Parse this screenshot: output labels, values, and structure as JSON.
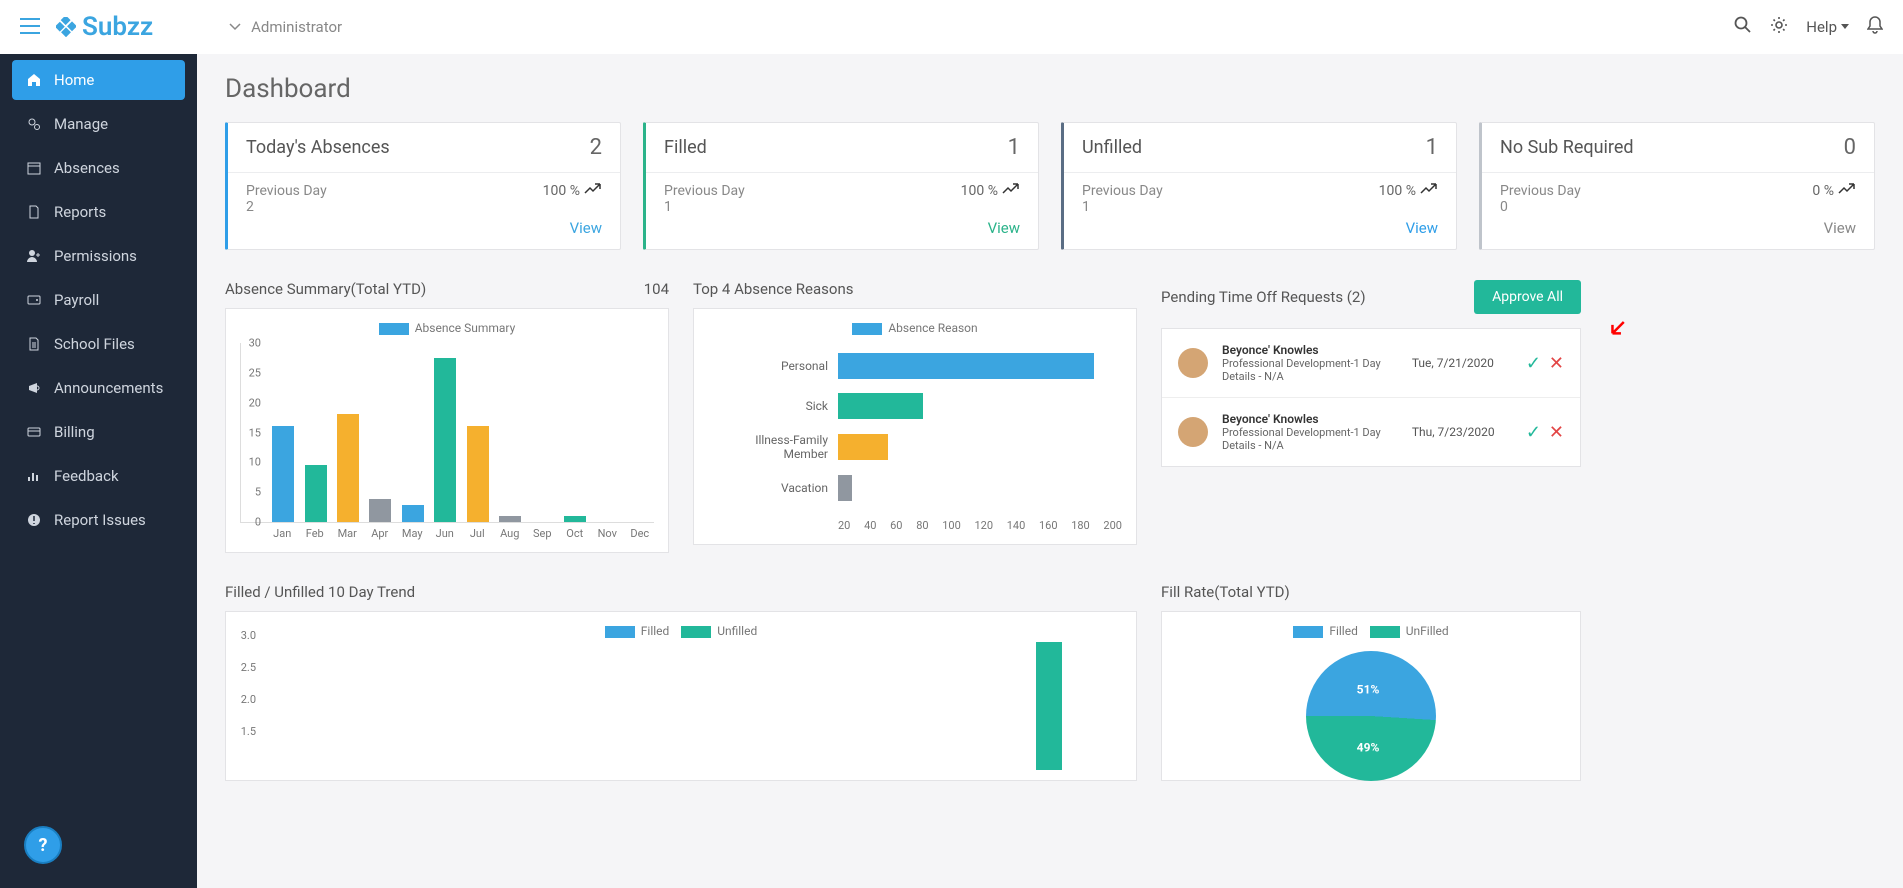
{
  "topbar": {
    "role": "Administrator",
    "help": "Help"
  },
  "sidebar": {
    "items": [
      {
        "label": "Home"
      },
      {
        "label": "Manage"
      },
      {
        "label": "Absences"
      },
      {
        "label": "Reports"
      },
      {
        "label": "Permissions"
      },
      {
        "label": "Payroll"
      },
      {
        "label": "School Files"
      },
      {
        "label": "Announcements"
      },
      {
        "label": "Billing"
      },
      {
        "label": "Feedback"
      },
      {
        "label": "Report Issues"
      }
    ]
  },
  "page": {
    "title": "Dashboard"
  },
  "stats": [
    {
      "title": "Today's Absences",
      "count": "2",
      "prev_label": "Previous Day",
      "prev_val": "2",
      "pct": "100 %",
      "view": "View"
    },
    {
      "title": "Filled",
      "count": "1",
      "prev_label": "Previous Day",
      "prev_val": "1",
      "pct": "100 %",
      "view": "View"
    },
    {
      "title": "Unfilled",
      "count": "1",
      "prev_label": "Previous Day",
      "prev_val": "1",
      "pct": "100 %",
      "view": "View"
    },
    {
      "title": "No Sub Required",
      "count": "0",
      "prev_label": "Previous Day",
      "prev_val": "0",
      "pct": "0 %",
      "view": "View"
    }
  ],
  "absence_summary": {
    "title": "Absence Summary(Total YTD)",
    "total": "104",
    "legend": "Absence Summary"
  },
  "top_reasons": {
    "title": "Top 4 Absence Reasons",
    "legend": "Absence Reason"
  },
  "pending": {
    "title": "Pending Time Off Requests (2)",
    "approve": "Approve All",
    "items": [
      {
        "name": "Beyonce' Knowles",
        "desc": "Professional Development-1 Day",
        "details": "Details - N/A",
        "date": "Tue, 7/21/2020"
      },
      {
        "name": "Beyonce' Knowles",
        "desc": "Professional Development-1 Day",
        "details": "Details - N/A",
        "date": "Thu, 7/23/2020"
      }
    ]
  },
  "trend": {
    "title": "Filled / Unfilled 10 Day Trend",
    "legend_filled": "Filled",
    "legend_unfilled": "Unfilled"
  },
  "fill_rate": {
    "title": "Fill Rate(Total YTD)",
    "legend_filled": "Filled",
    "legend_unfilled": "UnFilled",
    "filled_pct": "51%",
    "unfilled_pct": "49%"
  },
  "chart_data": [
    {
      "type": "bar",
      "name": "Absence Summary (Total YTD)",
      "categories": [
        "Jan",
        "Feb",
        "Mar",
        "Apr",
        "May",
        "Jun",
        "Jul",
        "Aug",
        "Sep",
        "Oct",
        "Nov",
        "Dec"
      ],
      "values": [
        17,
        10,
        19,
        4,
        3,
        29,
        17,
        1,
        0,
        1,
        0,
        0
      ],
      "colors": [
        "#3ba5e0",
        "#22b89a",
        "#f5b02e",
        "#9097a0",
        "#3ba5e0",
        "#22b89a",
        "#f5b02e",
        "#9097a0",
        "#3ba5e0",
        "#22b89a",
        "#f5b02e",
        "#9097a0"
      ],
      "ylim": [
        0,
        30
      ],
      "yticks": [
        0,
        5,
        10,
        15,
        20,
        25,
        30
      ]
    },
    {
      "type": "bar",
      "name": "Top 4 Absence Reasons",
      "orientation": "horizontal",
      "categories": [
        "Personal",
        "Sick",
        "Illness-Family Member",
        "Vacation"
      ],
      "values": [
        180,
        60,
        35,
        10
      ],
      "colors": [
        "#3ba5e0",
        "#22b89a",
        "#f5b02e",
        "#9097a0"
      ],
      "xlim": [
        0,
        200
      ],
      "xticks": [
        20,
        40,
        60,
        80,
        100,
        120,
        140,
        160,
        180,
        200
      ]
    },
    {
      "type": "bar",
      "name": "Filled / Unfilled 10 Day Trend",
      "series": [
        {
          "name": "Filled",
          "color": "#3ba5e0"
        },
        {
          "name": "Unfilled",
          "color": "#22b89a"
        }
      ],
      "ylim": [
        1.0,
        3.0
      ],
      "yticks": [
        1.5,
        2.0,
        2.5,
        3.0
      ],
      "visible_bar": {
        "series": "Unfilled",
        "value": 3.0,
        "position_index": 9
      }
    },
    {
      "type": "pie",
      "name": "Fill Rate (Total YTD)",
      "slices": [
        {
          "label": "Filled",
          "value": 51,
          "color": "#3ba5e0"
        },
        {
          "label": "UnFilled",
          "value": 49,
          "color": "#22b89a"
        }
      ]
    }
  ]
}
